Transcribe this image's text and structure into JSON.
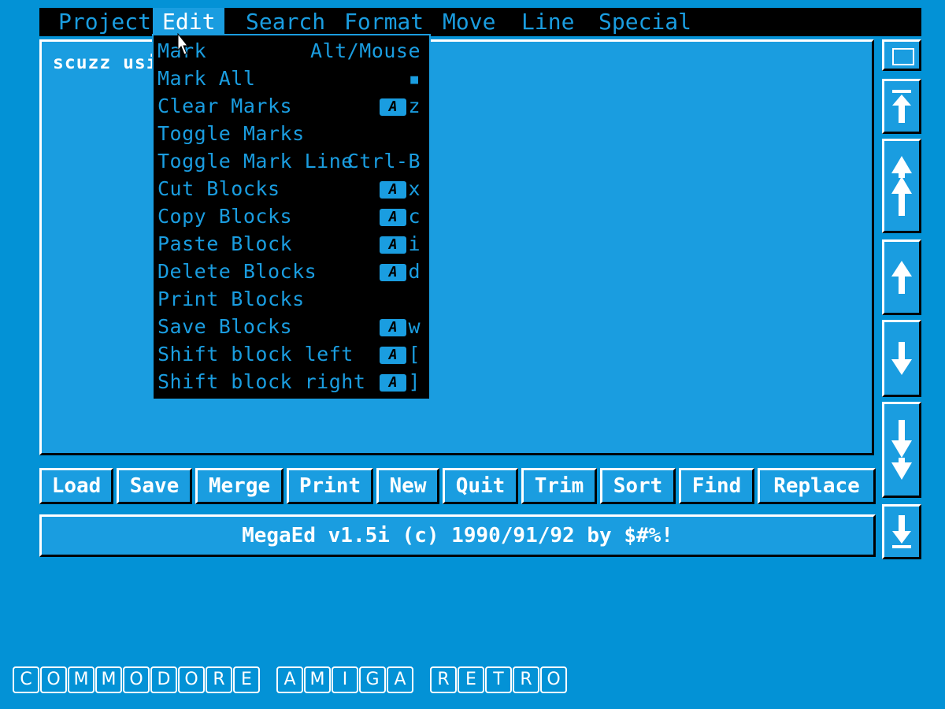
{
  "menubar": {
    "items": [
      "Project",
      "Edit",
      "Search",
      "Format",
      "Move",
      "Line",
      "Special"
    ],
    "active": "Edit"
  },
  "editor": {
    "text": "scuzz usi"
  },
  "edit_menu": {
    "items": [
      {
        "label": "Mark",
        "shortcut": "Alt/Mouse",
        "amiga": false
      },
      {
        "label": "Mark All",
        "shortcut": "▪",
        "amiga": false
      },
      {
        "label": "Clear Marks",
        "shortcut": "z",
        "amiga": true
      },
      {
        "label": "Toggle Marks",
        "shortcut": "",
        "amiga": false
      },
      {
        "label": "Toggle Mark Line",
        "shortcut": "Ctrl-B",
        "amiga": false
      },
      {
        "label": "Cut Blocks",
        "shortcut": "x",
        "amiga": true
      },
      {
        "label": "Copy Blocks",
        "shortcut": "c",
        "amiga": true
      },
      {
        "label": "Paste Block",
        "shortcut": "i",
        "amiga": true
      },
      {
        "label": "Delete Blocks",
        "shortcut": "d",
        "amiga": true
      },
      {
        "label": "Print Blocks",
        "shortcut": "",
        "amiga": false
      },
      {
        "label": "Save Blocks",
        "shortcut": "w",
        "amiga": true
      },
      {
        "label": "Shift block left",
        "shortcut": "[",
        "amiga": true
      },
      {
        "label": "Shift block right",
        "shortcut": "]",
        "amiga": true
      }
    ],
    "amiga_key_glyph": "A"
  },
  "buttons": [
    "Load",
    "Save",
    "Merge",
    "Print",
    "New",
    "Quit",
    "Trim",
    "Sort",
    "Find",
    "Replace"
  ],
  "status": {
    "text": "MegaEd v1.5i (c) 1990/91/92 by $#%!"
  },
  "scrollbar": {
    "icons": [
      "scroll-top-icon",
      "page-up-icon",
      "line-up-icon",
      "line-down-icon",
      "page-down-icon",
      "scroll-bottom-icon"
    ]
  },
  "watermark": {
    "words": [
      "COMMODORE",
      "AMIGA",
      "RETRO"
    ]
  },
  "colors": {
    "background": "#0392d6",
    "panel": "#1a9de0",
    "menu_bg": "#000000",
    "text": "#ffffff"
  }
}
